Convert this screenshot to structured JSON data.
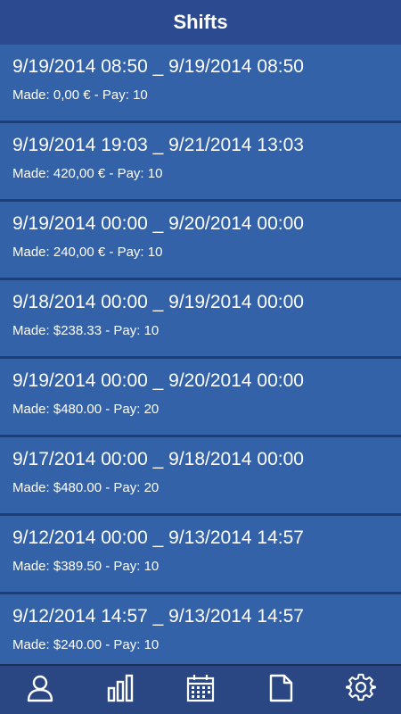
{
  "header": {
    "title": "Shifts"
  },
  "shifts": [
    {
      "dates": "9/19/2014 08:50 _ 9/19/2014 08:50",
      "meta": "Made: 0,00 € - Pay: 10"
    },
    {
      "dates": "9/19/2014 19:03 _ 9/21/2014 13:03",
      "meta": "Made: 420,00 € - Pay: 10"
    },
    {
      "dates": "9/19/2014 00:00 _ 9/20/2014 00:00",
      "meta": "Made: 240,00 € - Pay: 10"
    },
    {
      "dates": "9/18/2014 00:00 _ 9/19/2014 00:00",
      "meta": "Made: $238.33 - Pay: 10"
    },
    {
      "dates": "9/19/2014 00:00 _ 9/20/2014 00:00",
      "meta": "Made: $480.00 - Pay: 20"
    },
    {
      "dates": "9/17/2014 00:00 _ 9/18/2014 00:00",
      "meta": "Made: $480.00 - Pay: 20"
    },
    {
      "dates": "9/12/2014 00:00 _ 9/13/2014 14:57",
      "meta": "Made: $389.50 - Pay: 10"
    },
    {
      "dates": "9/12/2014 14:57 _ 9/13/2014 14:57",
      "meta": "Made: $240.00 - Pay: 10"
    }
  ],
  "tabbar": {
    "tabs": [
      {
        "icon": "person-icon"
      },
      {
        "icon": "bar-chart-icon"
      },
      {
        "icon": "calendar-icon"
      },
      {
        "icon": "document-icon"
      },
      {
        "icon": "gear-icon"
      }
    ]
  },
  "colors": {
    "header_bg": "#2c4a8f",
    "row_bg": "#3362a8",
    "divider": "#1f3f73",
    "tabbar_bg": "#2a4784",
    "text": "#ffffff"
  }
}
